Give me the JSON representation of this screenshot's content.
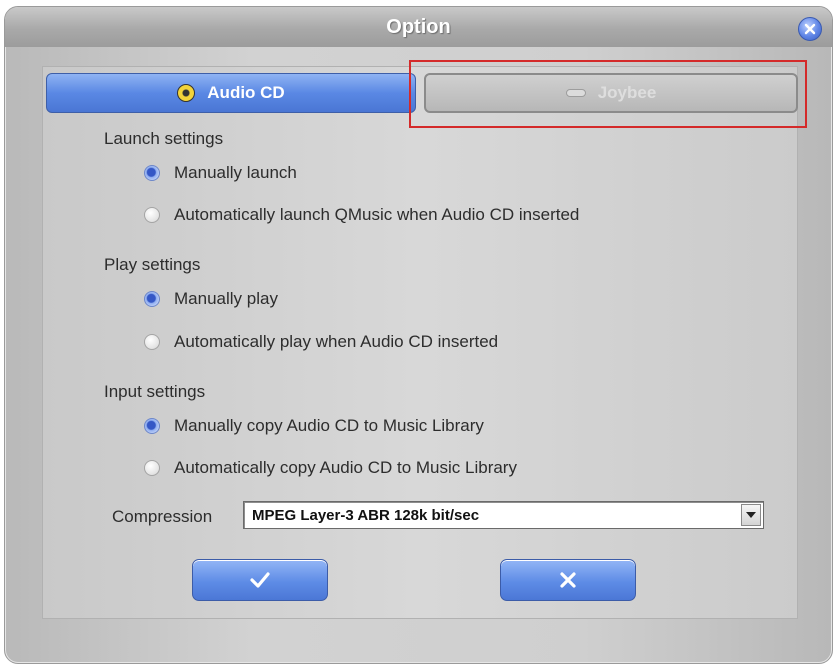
{
  "window": {
    "title": "Option"
  },
  "tabs": [
    {
      "label": "Audio CD",
      "icon": "cd-icon",
      "active": true
    },
    {
      "label": "Joybee",
      "icon": "joybee-device-icon",
      "active": false
    }
  ],
  "launch_settings": {
    "heading": "Launch settings",
    "options": [
      {
        "label": "Manually launch",
        "selected": true
      },
      {
        "label": "Automatically launch QMusic when Audio CD inserted",
        "selected": false
      }
    ]
  },
  "play_settings": {
    "heading": "Play settings",
    "options": [
      {
        "label": "Manually play",
        "selected": true
      },
      {
        "label": "Automatically play when Audio CD inserted",
        "selected": false
      }
    ]
  },
  "input_settings": {
    "heading": "Input settings",
    "options": [
      {
        "label": "Manually copy Audio CD to Music Library",
        "selected": true
      },
      {
        "label": "Automatically copy Audio CD to Music Library",
        "selected": false
      }
    ]
  },
  "compression": {
    "label": "Compression",
    "value": "MPEG Layer-3 ABR 128k bit/sec"
  },
  "buttons": {
    "ok_icon": "checkmark-icon",
    "cancel_icon": "x-icon"
  },
  "colors": {
    "accent_blue": "#5a88e4",
    "highlight_red": "#d42a2a"
  }
}
